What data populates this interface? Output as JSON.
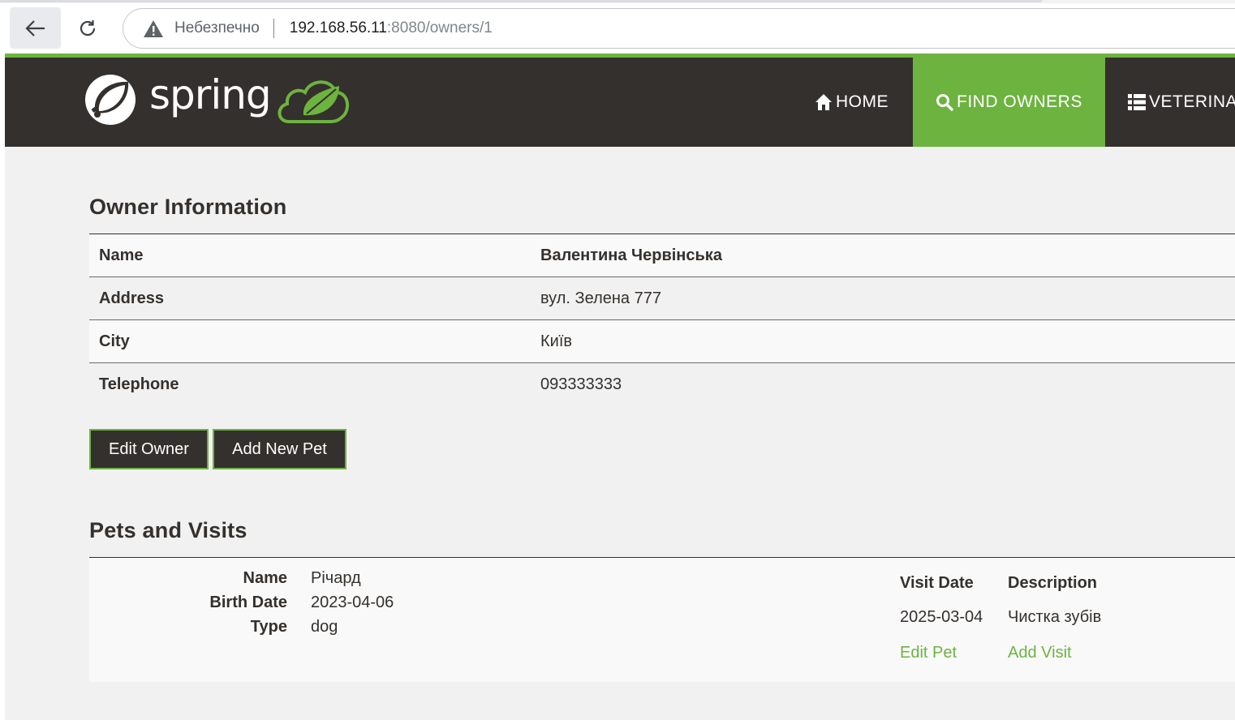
{
  "browser": {
    "security_label": "Небезпечно",
    "url_host": "192.168.56.11",
    "url_path": ":8080/owners/1"
  },
  "nav": {
    "logo_text": "spring",
    "items": [
      {
        "label": "HOME",
        "icon": "home-icon"
      },
      {
        "label": "FIND OWNERS",
        "icon": "search-icon",
        "active": true
      },
      {
        "label": "VETERINA",
        "icon": "list-icon"
      }
    ]
  },
  "owner": {
    "title": "Owner Information",
    "rows": [
      {
        "label": "Name",
        "value": "Валентина Червінська"
      },
      {
        "label": "Address",
        "value": "вул. Зелена 777"
      },
      {
        "label": "City",
        "value": "Київ"
      },
      {
        "label": "Telephone",
        "value": "093333333"
      }
    ],
    "edit_button": "Edit Owner",
    "add_pet_button": "Add New Pet"
  },
  "pets": {
    "title": "Pets and Visits",
    "items": [
      {
        "fields": [
          {
            "label": "Name",
            "value": "Річард"
          },
          {
            "label": "Birth Date",
            "value": "2023-04-06"
          },
          {
            "label": "Type",
            "value": "dog"
          }
        ],
        "visits_header": {
          "date": "Visit Date",
          "description": "Description"
        },
        "visits": [
          {
            "date": "2025-03-04",
            "description": "Чистка зубів"
          }
        ],
        "edit_pet_link": "Edit Pet",
        "add_visit_link": "Add Visit"
      }
    ]
  },
  "colors": {
    "brand_green": "#6db33f",
    "dark": "#34302d",
    "background": "#f1f1f1"
  }
}
